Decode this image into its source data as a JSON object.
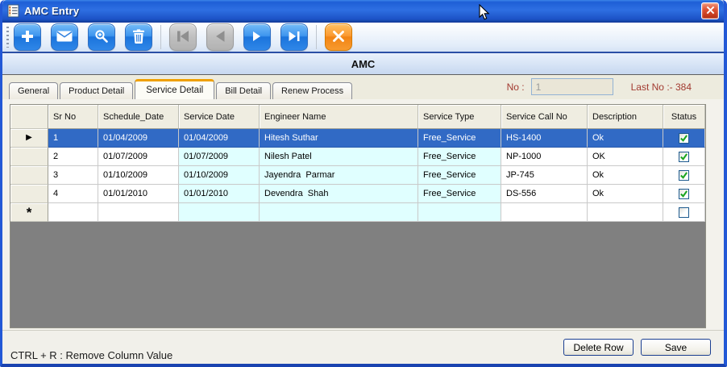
{
  "window": {
    "title": "AMC Entry"
  },
  "titlebar": {
    "icon": "notepad-icon",
    "close_icon": "close-x-icon"
  },
  "toolbar": {
    "buttons": [
      {
        "name": "add",
        "icon": "plus-icon",
        "enabled": true
      },
      {
        "name": "mail",
        "icon": "envelope-icon",
        "enabled": true
      },
      {
        "name": "search",
        "icon": "magnifier-zoom-icon",
        "enabled": true
      },
      {
        "name": "delete",
        "icon": "trash-icon",
        "enabled": true
      },
      {
        "name": "first-record",
        "icon": "first-record-icon",
        "enabled": false
      },
      {
        "name": "previous-record",
        "icon": "previous-record-icon",
        "enabled": false
      },
      {
        "name": "next-record",
        "icon": "next-record-icon",
        "enabled": true
      },
      {
        "name": "last-record",
        "icon": "last-record-icon",
        "enabled": true
      },
      {
        "name": "cancel",
        "icon": "cancel-x-icon",
        "enabled": true,
        "accent": "#F28414"
      }
    ]
  },
  "header": {
    "title": "AMC"
  },
  "tabs": [
    {
      "label": "General",
      "active": false
    },
    {
      "label": "Product Detail",
      "active": false
    },
    {
      "label": "Service Detail",
      "active": true
    },
    {
      "label": "Bill Detail",
      "active": false
    },
    {
      "label": "Renew Process",
      "active": false
    }
  ],
  "record_nav": {
    "no_label": "No :",
    "no_value": "1",
    "last_no_label": "Last No :- 384"
  },
  "grid": {
    "columns": [
      "Sr No",
      "Schedule_Date",
      "Service Date",
      "Engineer Name",
      "Service Type",
      "Service Call No",
      "Description",
      "Status"
    ],
    "rows": [
      {
        "cells": [
          "1",
          "01/04/2009",
          "01/04/2009",
          "Hitesh Suthar",
          "Free_Service",
          "HS-1400",
          "Ok"
        ],
        "status_checked": true,
        "selected": true
      },
      {
        "cells": [
          "2",
          "01/07/2009",
          "01/07/2009",
          "Nilesh Patel",
          "Free_Service",
          "NP-1000",
          "OK"
        ],
        "status_checked": true,
        "selected": false
      },
      {
        "cells": [
          "3",
          "01/10/2009",
          "01/10/2009",
          "Jayendra  Parmar",
          "Free_Service",
          "JP-745",
          "Ok"
        ],
        "status_checked": true,
        "selected": false
      },
      {
        "cells": [
          "4",
          "01/01/2010",
          "01/01/2010",
          "Devendra  Shah",
          "Free_Service",
          "DS-556",
          "Ok"
        ],
        "status_checked": true,
        "selected": false
      }
    ],
    "new_row_marker": "*",
    "current_row_arrow": "▶"
  },
  "footer": {
    "hint": "CTRL + R : Remove Column Value",
    "delete_row_label": "Delete Row",
    "save_label": "Save"
  },
  "colors": {
    "selection_blue": "#316AC5",
    "cell_cyan": "#E0FFFF",
    "label_maroon": "#A23A30",
    "toolbar_button_blue": "#1B74DC",
    "cancel_orange": "#F28414",
    "grid_empty_gray": "#808080"
  }
}
